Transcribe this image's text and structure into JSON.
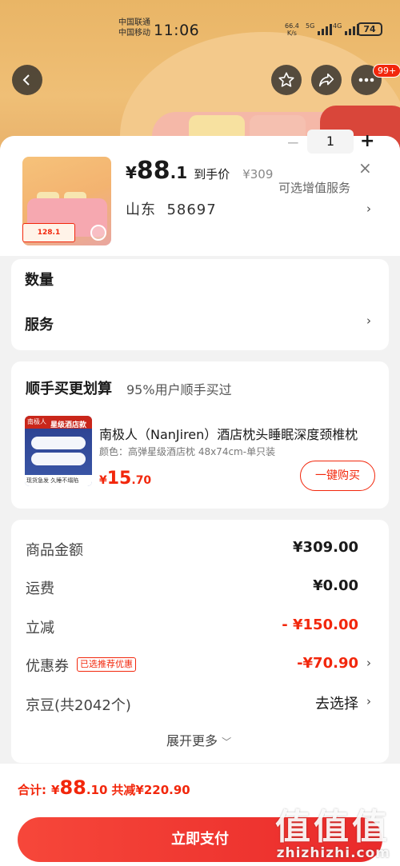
{
  "status_bar": {
    "carrier1": "中国联通",
    "carrier2": "中国移动",
    "time": "11:06",
    "net_speed": "66.4",
    "net_unit": "K/s",
    "sig1": "5G",
    "sig2": "4G",
    "battery": "74"
  },
  "top_nav": {
    "back_icon": "chevron-left-icon",
    "fav_icon": "star-icon",
    "share_icon": "share-icon",
    "more_icon": "more-icon",
    "badge": "99+"
  },
  "product": {
    "thumb_tag": "128.1",
    "price_yen": "¥",
    "price_int": "88",
    "price_dec": ".1",
    "price_tag": "到手价",
    "original_price": "¥309",
    "close": "×",
    "region": "山东",
    "postcode": "58697"
  },
  "options": {
    "qty_label": "数量",
    "qty_minus": "−",
    "qty_value": "1",
    "qty_plus": "+",
    "service_label": "服务",
    "service_hint": "可选增值服务"
  },
  "bundle": {
    "title": "顺手买更划算",
    "subtitle": "95%用户顺手买过",
    "thumb_brand": "南极人",
    "thumb_label": "星级酒店款",
    "thumb_footer": "现货急发 久睡不塌陷",
    "name": "南极人（NanJiren）酒店枕头睡眠深度颈椎枕",
    "spec": "颜色：高弹星级酒店枕 48x74cm-单只装",
    "price_yen": "¥",
    "price_int": "15",
    "price_dec": ".70",
    "buy_button": "一键购买"
  },
  "summary": {
    "rows": [
      {
        "label": "商品金额",
        "value": "¥309.00"
      },
      {
        "label": "运费",
        "value": "¥0.00"
      },
      {
        "label": "立减",
        "value": "- ¥150.00"
      },
      {
        "label": "优惠券",
        "value": "-¥70.90"
      },
      {
        "label": "京豆(共2042个)",
        "value": "去选择"
      }
    ],
    "coupon_tag": "已选推荐优惠",
    "expand": "展开更多"
  },
  "footer": {
    "total_label": "合计:",
    "total_yen": "¥",
    "total_int": "88",
    "total_dec": ".10",
    "saved": "共减¥220.90",
    "pay_button": "立即支付"
  },
  "watermark": {
    "logo": "值值值",
    "site": "zhizhizhi.com"
  },
  "colors": {
    "accent": "#f2270c",
    "pay_gradient_start": "#f6473a",
    "pay_gradient_end": "#ea2a2a"
  }
}
